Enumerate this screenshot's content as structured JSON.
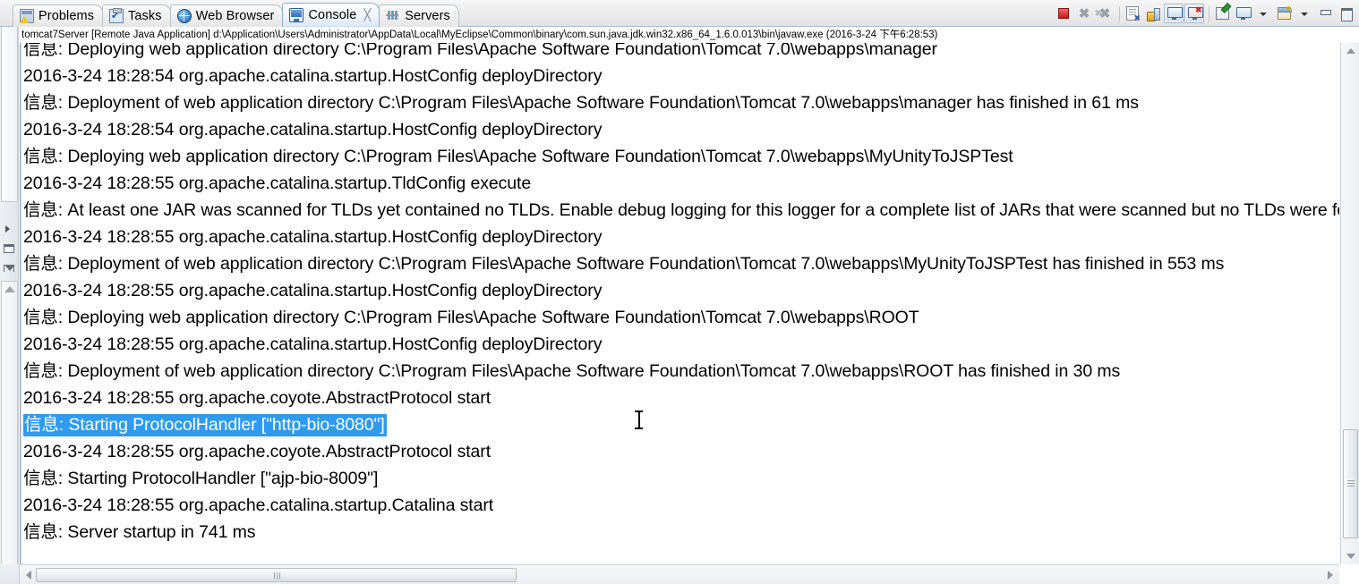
{
  "window": {
    "view_tabs": [
      {
        "label": "Problems",
        "icon": "problems-icon",
        "active": false,
        "closable": false
      },
      {
        "label": "Tasks",
        "icon": "tasks-icon",
        "active": false,
        "closable": false
      },
      {
        "label": "Web Browser",
        "icon": "globe-icon",
        "active": false,
        "closable": false
      },
      {
        "label": "Console",
        "icon": "console-icon",
        "active": true,
        "closable": true
      },
      {
        "label": "Servers",
        "icon": "servers-icon",
        "active": false,
        "closable": false
      }
    ],
    "close_glyph": "╳"
  },
  "toolbar": {
    "buttons": [
      {
        "name": "terminate-button",
        "icon": "stop-icon",
        "label": "Terminate"
      },
      {
        "name": "remove-launch-button",
        "icon": "remove-x-icon",
        "label": "Remove Launch"
      },
      {
        "name": "remove-all-terminated-button",
        "icon": "remove-all-x-icon",
        "label": "Remove All Terminated Launches"
      },
      {
        "name": "clear-console-button",
        "icon": "clear-console-icon",
        "label": "Clear Console"
      },
      {
        "name": "scroll-lock-button",
        "icon": "lock-icon",
        "label": "Scroll Lock"
      },
      {
        "name": "pin-console-button",
        "icon": "pin-console-icon",
        "label": "Pin Console"
      },
      {
        "name": "display-selected-console-button",
        "icon": "display-console-icon",
        "label": "Display Selected Console"
      },
      {
        "name": "word-wrap-button",
        "icon": "note-pencil-icon",
        "label": "Word Wrap"
      },
      {
        "name": "open-console-button",
        "icon": "monitor-icon",
        "label": "Open Console"
      },
      {
        "name": "open-console-menu-button",
        "icon": "chevron-down-icon",
        "label": "Open Console Menu"
      },
      {
        "name": "new-console-view-button",
        "icon": "new-console-icon",
        "label": "New Console View"
      },
      {
        "name": "view-menu-button",
        "icon": "chevron-down-icon",
        "label": "View Menu"
      },
      {
        "name": "minimize-button",
        "icon": "minimize-icon",
        "label": "Minimize"
      },
      {
        "name": "maximize-button",
        "icon": "maximize-icon",
        "label": "Maximize"
      }
    ]
  },
  "console": {
    "process_line": "tomcat7Server [Remote Java Application] d:\\Application\\Users\\Administrator\\AppData\\Local\\MyEclipse\\Common\\binary\\com.sun.java.jdk.win32.x86_64_1.6.0.013\\bin\\javaw.exe (2016-3-24 下午6:28:53)",
    "selection_color": "#2e9bf0",
    "selection_text_color": "#ffffff",
    "lines": [
      {
        "text": "信息: Deploying web application directory C:\\Program Files\\Apache Software Foundation\\Tomcat 7.0\\webapps\\manager",
        "selected": false
      },
      {
        "text": "2016-3-24 18:28:54 org.apache.catalina.startup.HostConfig deployDirectory",
        "selected": false
      },
      {
        "text": "信息: Deployment of web application directory C:\\Program Files\\Apache Software Foundation\\Tomcat 7.0\\webapps\\manager has finished in 61 ms",
        "selected": false
      },
      {
        "text": "2016-3-24 18:28:54 org.apache.catalina.startup.HostConfig deployDirectory",
        "selected": false
      },
      {
        "text": "信息: Deploying web application directory C:\\Program Files\\Apache Software Foundation\\Tomcat 7.0\\webapps\\MyUnityToJSPTest",
        "selected": false
      },
      {
        "text": "2016-3-24 18:28:55 org.apache.catalina.startup.TldConfig execute",
        "selected": false
      },
      {
        "text": "信息: At least one JAR was scanned for TLDs yet contained no TLDs. Enable debug logging for this logger for a complete list of JARs that were scanned but no TLDs were found in them.",
        "selected": false
      },
      {
        "text": "2016-3-24 18:28:55 org.apache.catalina.startup.HostConfig deployDirectory",
        "selected": false
      },
      {
        "text": "信息: Deployment of web application directory C:\\Program Files\\Apache Software Foundation\\Tomcat 7.0\\webapps\\MyUnityToJSPTest has finished in 553 ms",
        "selected": false
      },
      {
        "text": "2016-3-24 18:28:55 org.apache.catalina.startup.HostConfig deployDirectory",
        "selected": false
      },
      {
        "text": "信息: Deploying web application directory C:\\Program Files\\Apache Software Foundation\\Tomcat 7.0\\webapps\\ROOT",
        "selected": false
      },
      {
        "text": "2016-3-24 18:28:55 org.apache.catalina.startup.HostConfig deployDirectory",
        "selected": false
      },
      {
        "text": "信息: Deployment of web application directory C:\\Program Files\\Apache Software Foundation\\Tomcat 7.0\\webapps\\ROOT has finished in 30 ms",
        "selected": false
      },
      {
        "text": "2016-3-24 18:28:55 org.apache.coyote.AbstractProtocol start",
        "selected": false
      },
      {
        "text": "信息: Starting ProtocolHandler [\"http-bio-8080\"]",
        "selected": true
      },
      {
        "text": "2016-3-24 18:28:55 org.apache.coyote.AbstractProtocol start",
        "selected": false
      },
      {
        "text": "信息: Starting ProtocolHandler [\"ajp-bio-8009\"]",
        "selected": false
      },
      {
        "text": "2016-3-24 18:28:55 org.apache.catalina.startup.Catalina start",
        "selected": false
      },
      {
        "text": "信息: Server startup in 741 ms",
        "selected": false
      }
    ]
  },
  "scrollbars": {
    "vertical": {
      "position_percent": 80
    },
    "horizontal": {
      "position_percent": 0
    }
  }
}
